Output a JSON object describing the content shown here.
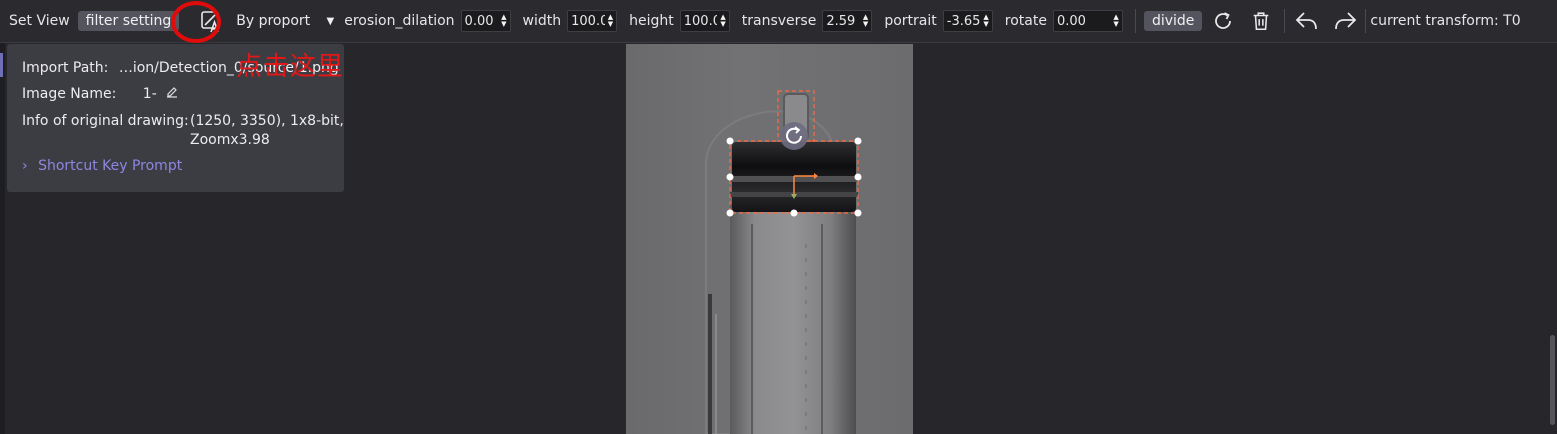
{
  "toolbar": {
    "set_view_label": "Set View",
    "filter_setting_label": "filter setting",
    "scale_mode": "By proport",
    "erosion_dilation": {
      "label": "erosion_dilation",
      "value": "0.00"
    },
    "width": {
      "label": "width",
      "value": "100.0"
    },
    "height": {
      "label": "height",
      "value": "100.0"
    },
    "transverse": {
      "label": "transverse",
      "value": "2.59"
    },
    "portrait": {
      "label": "portrait",
      "value": "-3.65"
    },
    "rotate": {
      "label": "rotate",
      "value": "0.00"
    },
    "divide_label": "divide",
    "current_transform_label": "current transform: T0"
  },
  "info": {
    "import_path_label": "Import Path:",
    "import_path_value": "…ion/Detection_0/source/1.png",
    "image_name_label": "Image Name:",
    "image_name_value": "1-",
    "original_label": "Info of original drawing:",
    "original_value_line1": "(1250, 3350), 1x8-bit,",
    "original_value_line2": "Zoomx3.98",
    "shortcut_label": "Shortcut Key Prompt"
  },
  "annotation": {
    "text": "点击这里",
    "color": "#e01818"
  },
  "colors": {
    "accent": "#8f86e0",
    "selection": "#ff6a3d"
  },
  "icons": [
    "image-text-icon",
    "dropdown-arrow-icon",
    "refresh-icon",
    "trash-icon",
    "undo-icon",
    "redo-icon",
    "edit-icon",
    "chevron-right-icon",
    "rotate-handle-icon"
  ]
}
